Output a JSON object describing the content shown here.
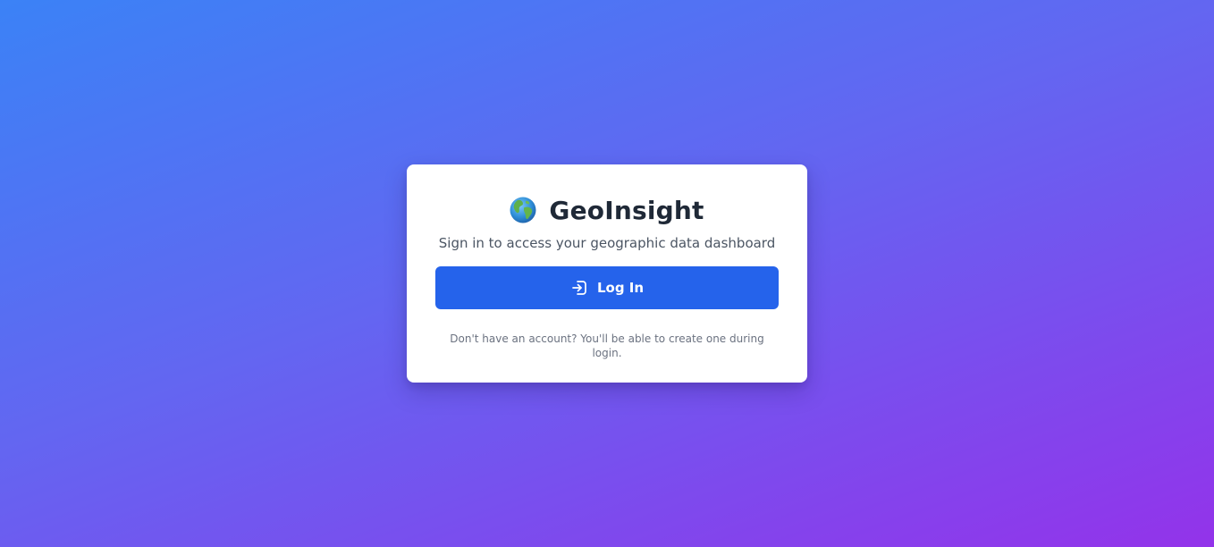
{
  "app": {
    "title": "GeoInsight",
    "logo_icon": "globe-icon"
  },
  "login_card": {
    "subtitle": "Sign in to access your geographic data dashboard",
    "login_button": {
      "label": "Log In",
      "icon": "login-icon"
    },
    "footnote": "Don't have an account? You'll be able to create one during login."
  },
  "colors": {
    "background_start": "#3b82f6",
    "background_end": "#9333ea",
    "card": "#ffffff",
    "button": "#2563eb",
    "title_text": "#1f2937",
    "subtitle_text": "#4b5563",
    "footnote_text": "#6b7280"
  }
}
